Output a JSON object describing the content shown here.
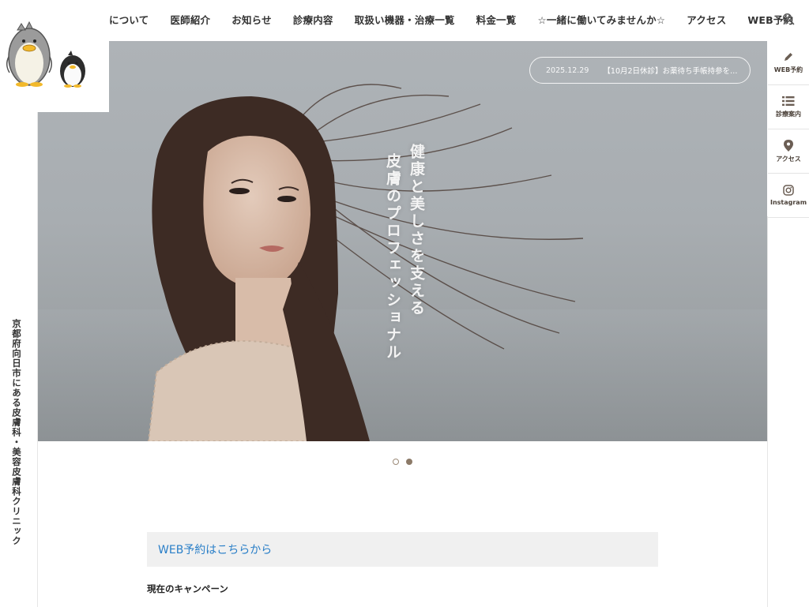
{
  "nav": {
    "items": [
      "について",
      "医師紹介",
      "お知らせ",
      "診療内容",
      "取扱い機器・治療一覧",
      "料金一覧",
      "☆一緒に働いてみませんか☆",
      "アクセス",
      "WEB予約"
    ],
    "search_icon": "search-icon"
  },
  "tagline_vertical": "京都府向日市にある皮膚科・美容皮膚科クリニック",
  "hero": {
    "news_date": "2025.12.29",
    "news_title": "【10月2日休診】お薬待ち手帳持参を…",
    "catch_line1": "健康と美しさを支える",
    "catch_line2": "皮膚のプロフェッショナル"
  },
  "side_menu": [
    {
      "label": "WEB予約",
      "icon": "pencil-icon"
    },
    {
      "label": "診療案内",
      "icon": "list-icon"
    },
    {
      "label": "アクセス",
      "icon": "map-pin-icon"
    },
    {
      "label": "Instagram",
      "icon": "instagram-icon"
    }
  ],
  "slider": {
    "count": 2,
    "active": 2
  },
  "booking": {
    "link_text": "WEB予約はこちらから"
  },
  "campaign": {
    "heading": "現在のキャンペーン"
  },
  "colors": {
    "accent_brown": "#8c7a68",
    "link_blue": "#2a7fc8",
    "banner_bg": "#f0f0f0"
  }
}
